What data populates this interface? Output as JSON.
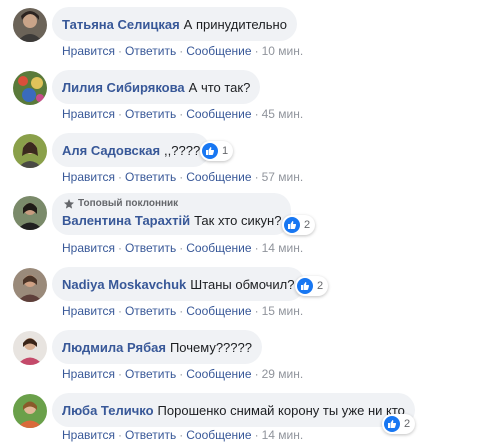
{
  "actions": {
    "like": "Нравится",
    "reply": "Ответить",
    "message": "Сообщение",
    "separator": "·"
  },
  "colors": {
    "name": "#385898",
    "bubble": "#f0f2f5",
    "like_blue": "#1877f2",
    "muted": "#90949c"
  },
  "comments": [
    {
      "name": "Татьяна Селицкая",
      "text": "А принудительно",
      "time": "10 мин."
    },
    {
      "name": "Лилия Сибирякова",
      "text": "А что так?",
      "time": "45 мин."
    },
    {
      "name": "Аля Садовская",
      "text": ",,????",
      "time": "57 мин.",
      "reactions": "1"
    },
    {
      "name": "Валентина Тарахтій",
      "text": "Так хто сикун?",
      "time": "14 мин.",
      "reactions": "2",
      "badge": "Топовый поклонник"
    },
    {
      "name": "Nadiya Moskavchuk",
      "text": "Штаны обмочил?",
      "time": "15 мин.",
      "reactions": "2"
    },
    {
      "name": "Людмила Рябая",
      "text": "Почему?????",
      "time": "29 мин."
    },
    {
      "name": "Люба Теличко",
      "text": "Порошенко снимай корону ты уже ни кто",
      "time": "14 мин.",
      "reactions": "2"
    }
  ]
}
